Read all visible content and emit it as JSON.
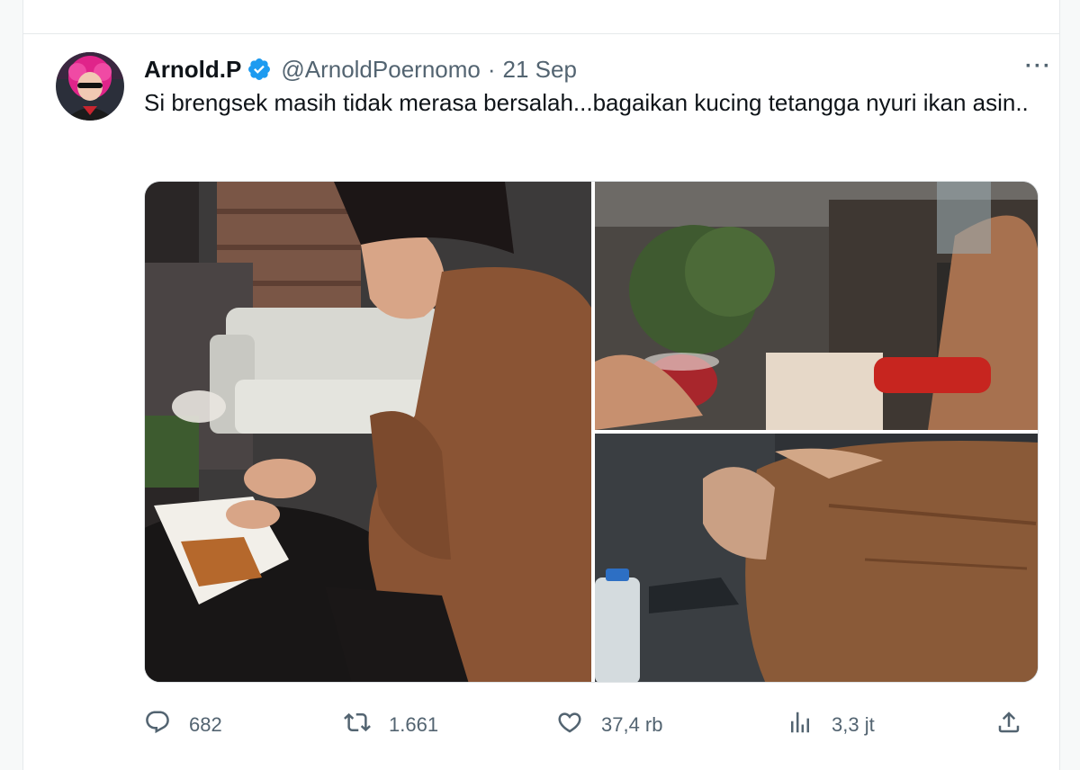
{
  "tweet": {
    "author_name": "Arnold.P",
    "handle": "@ArnoldPoernomo",
    "separator": "·",
    "date": "21 Sep",
    "text": "Si brengsek masih tidak merasa bersalah...bagaikan kucing tetangga nyuri ikan asin..",
    "more_label": "···"
  },
  "actions": {
    "replies": "682",
    "retweets": "1.661",
    "likes": "37,4 rb",
    "views": "3,3 jt"
  },
  "icons": {
    "verified": "verified-badge-icon",
    "reply": "reply-icon",
    "retweet": "retweet-icon",
    "like": "heart-icon",
    "views": "views-icon",
    "share": "share-icon"
  },
  "colors": {
    "verified": "#1d9bf0",
    "secondary_text": "#536471",
    "avatar_hair": "#e0248a"
  }
}
